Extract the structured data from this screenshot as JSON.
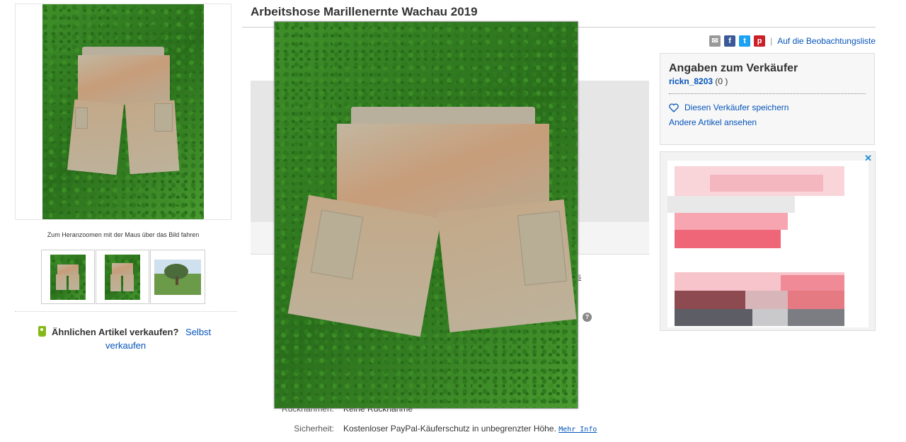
{
  "listing": {
    "title": "Arbeitshose Marillenernte Wachau 2019"
  },
  "gallery": {
    "zoom_hint": "Zum Heranzoomen mit der Maus über das Bild fahren",
    "thumbnails": [
      "shorts-front-thumbnail",
      "shorts-side-thumbnail",
      "orchard-tree-thumbnail"
    ]
  },
  "sell_similar": {
    "question": "Ähnlichen Artikel verkaufen?",
    "link_part1": "Selbst",
    "link_part2": "verkaufen"
  },
  "share": {
    "icons": [
      "email-icon",
      "facebook-icon",
      "twitter-icon",
      "pinterest-icon"
    ],
    "separator": "|",
    "watchlist_link": "Auf die Beobachtungsliste"
  },
  "seller": {
    "heading": "Angaben zum Verkäufer",
    "name": "rickn_8203",
    "score": "(0 )",
    "save_seller": "Diesen Verkäufer speichern",
    "other_items": "Andere Artikel ansehen"
  },
  "ad": {
    "close_label": "✕"
  },
  "details": {
    "return_label": "Rücknahmen:",
    "return_value": "Keine Rücknahme",
    "security_label": "Sicherheit:",
    "security_value": "Kostenloser PayPal-Käuferschutz in unbegrenzter Höhe.",
    "more_info": "Mehr Info"
  },
  "misc": {
    "help_icon_glyph": "?",
    "stray_text": "s"
  },
  "colors": {
    "link": "#0654ba",
    "grass": "#3f8f2a",
    "shorts": "#c2b7a0"
  }
}
